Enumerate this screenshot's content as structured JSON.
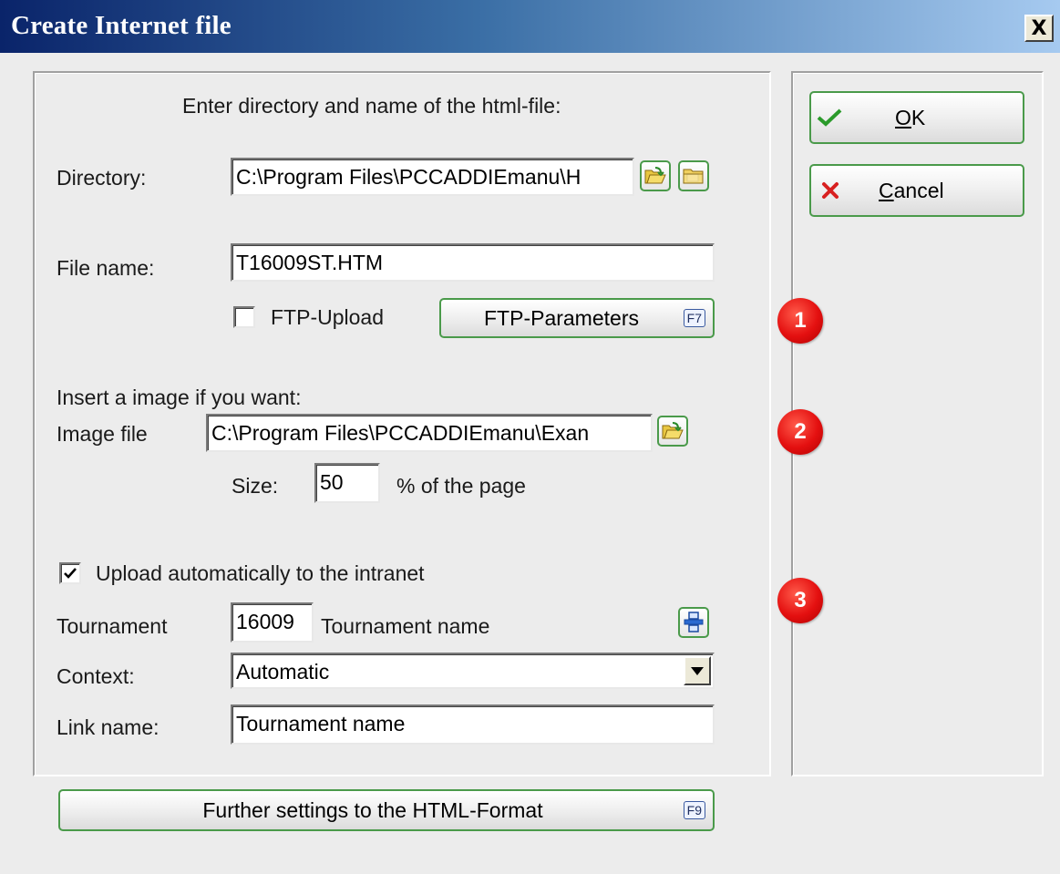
{
  "window": {
    "title": "Create Internet file",
    "close_label": "X"
  },
  "main": {
    "heading": "Enter directory and name of the html-file:",
    "directory": {
      "label": "Directory:",
      "value": "C:\\Program Files\\PCCADDIEmanu\\H"
    },
    "file_name": {
      "label": "File name:",
      "value": "T16009ST.HTM"
    },
    "ftp_upload": {
      "label": "FTP-Upload",
      "checked": false
    },
    "ftp_params": {
      "label": "FTP-Parameters",
      "shortcut": "F7"
    },
    "image_section_label": "Insert a image if you want:",
    "image_file": {
      "label": "Image file",
      "value": "C:\\Program Files\\PCCADDIEmanu\\Exan"
    },
    "size": {
      "label": "Size:",
      "value": "50",
      "suffix": "% of the page"
    },
    "upload_intranet": {
      "label": "Upload automatically to the intranet",
      "checked": true
    },
    "tournament": {
      "label": "Tournament",
      "id": "16009",
      "name": "Tournament name"
    },
    "context": {
      "label": "Context:",
      "value": "Automatic"
    },
    "link_name": {
      "label": "Link name:",
      "value": "Tournament name"
    },
    "further_settings": {
      "label": "Further settings to the HTML-Format",
      "shortcut": "F9"
    }
  },
  "side": {
    "ok": {
      "label_prefix": "",
      "label_mnemonic": "O",
      "label_rest": "K"
    },
    "cancel": {
      "label_mnemonic": "C",
      "label_rest": "ancel"
    }
  },
  "markers": [
    "1",
    "2",
    "3"
  ],
  "colors": {
    "accent_green": "#4a9a4a",
    "marker_red": "#e41010",
    "title_blue": "#0a246a"
  }
}
